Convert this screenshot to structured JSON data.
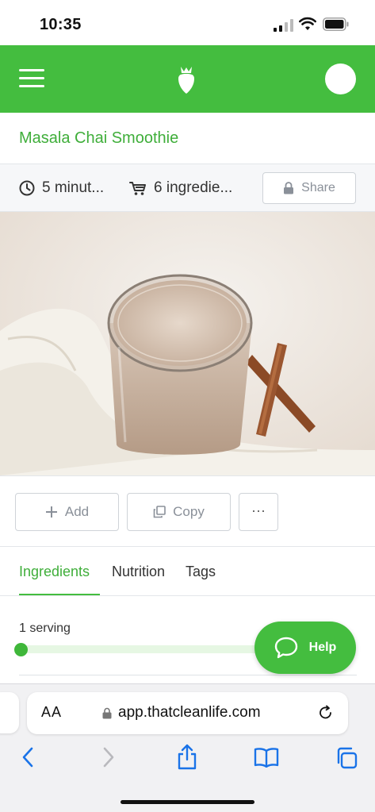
{
  "status_bar": {
    "time": "10:35"
  },
  "header": {
    "menu_icon": "hamburger-icon",
    "logo_icon": "strawberry-logo-icon",
    "avatar": "user-avatar"
  },
  "recipe": {
    "title": "Masala Chai Smoothie",
    "time": "5 minut...",
    "ingredients_count": "6 ingredie...",
    "share_label": "Share"
  },
  "actions": {
    "add_label": "Add",
    "copy_label": "Copy",
    "more_label": "···"
  },
  "tabs": [
    {
      "label": "Ingredients",
      "active": true
    },
    {
      "label": "Nutrition",
      "active": false
    },
    {
      "label": "Tags",
      "active": false
    }
  ],
  "serving": {
    "label": "1 serving",
    "slider_level": 0
  },
  "help": {
    "label": "Help"
  },
  "browser": {
    "text_size_label": "AA",
    "url": "app.thatcleanlife.com"
  },
  "colors": {
    "brand_green": "#44bd3f",
    "title_green": "#3fae3a"
  }
}
